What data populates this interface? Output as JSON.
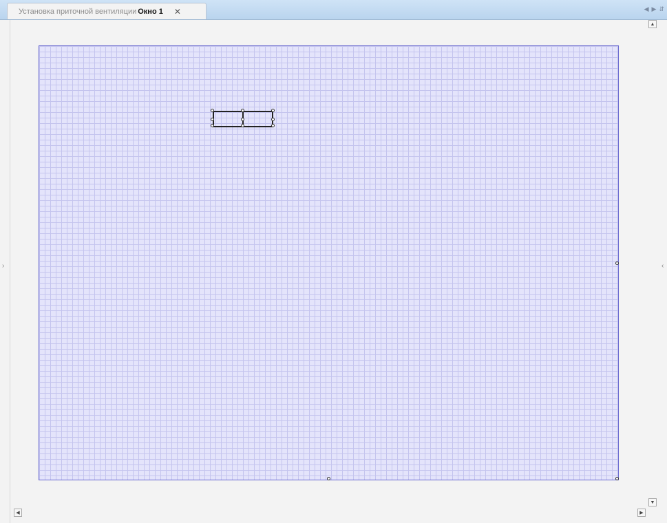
{
  "tab": {
    "prefix": "Установка приточной вентиляции",
    "title": "Окно 1",
    "close_glyph": "✕"
  },
  "nav": {
    "left_arrow": "◀",
    "right_arrow": "▶",
    "menu": "⇵"
  },
  "gutters": {
    "left_expander": "›",
    "right_expander": "‹"
  },
  "scroll": {
    "up": "▲",
    "down": "▼",
    "left": "◀",
    "right": "▶"
  },
  "colors": {
    "canvas_fill": "#e4e4fb",
    "canvas_border": "#6868d0",
    "grid_line": "#c4c4ee",
    "tab_strip": "#cfe3f6"
  }
}
